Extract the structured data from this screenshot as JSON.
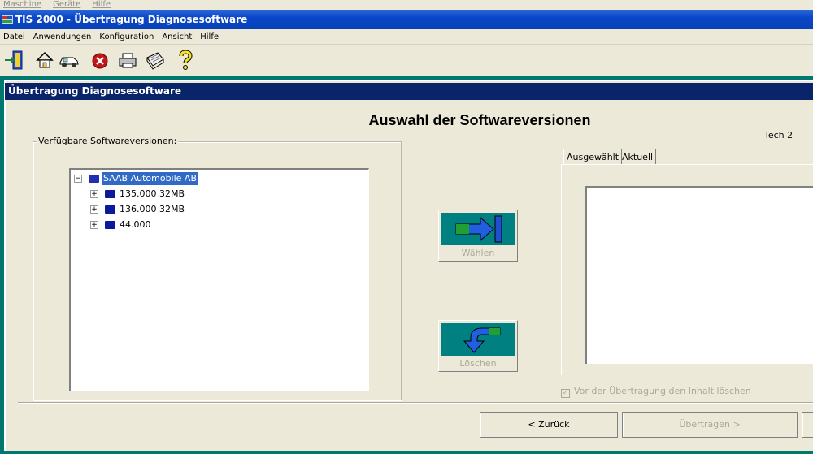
{
  "host_menu": [
    "Maschine",
    "Geräte",
    "Hilfe"
  ],
  "window": {
    "title": "TIS 2000 - Übertragung Diagnosesoftware"
  },
  "app_menu": [
    "Datei",
    "Anwendungen",
    "Konfiguration",
    "Ansicht",
    "Hilfe"
  ],
  "toolbar": [
    "exit-door-icon",
    "home-icon",
    "car-icon",
    "stop-icon",
    "printer-icon",
    "document-icon",
    "help-icon"
  ],
  "panel": {
    "title": "Übertragung Diagnosesoftware"
  },
  "heading": "Auswahl der Softwareversionen",
  "device": "Tech 2",
  "available": {
    "label": "Verfügbare Softwareversionen:",
    "root": "SAAB Automobile AB",
    "items": [
      "135.000 32MB",
      "136.000 32MB",
      "44.000"
    ]
  },
  "select_button": {
    "label": "Wählen"
  },
  "delete_button": {
    "label": "Löschen"
  },
  "tabs": [
    "Ausgewählt",
    "Aktuell"
  ],
  "checkbox": {
    "label": "Vor der Übertragung den Inhalt löschen",
    "checked": true
  },
  "buttons": {
    "back": "< Zurück",
    "transfer": "Übertragen >"
  },
  "colors": {
    "title_bar": "#0a46c8",
    "panel_bar": "#0a246a",
    "frame": "#00786f",
    "button_face": "#008080"
  }
}
